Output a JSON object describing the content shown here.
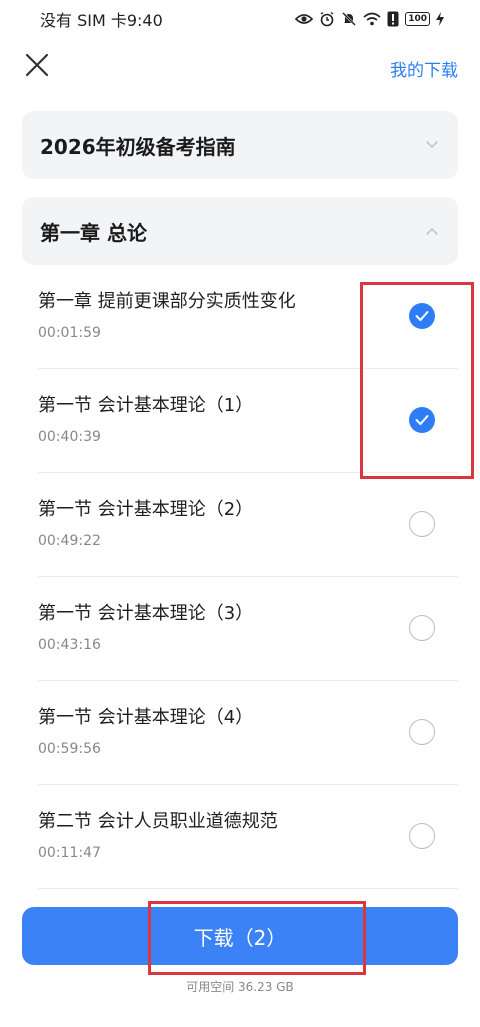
{
  "status_bar": {
    "carrier": "没有 SIM 卡",
    "time": "9:40",
    "battery": "100"
  },
  "header": {
    "close_icon": "close-icon",
    "my_downloads": "我的下载"
  },
  "sections": [
    {
      "title": "2026年初级备考指南",
      "expanded": false
    },
    {
      "title": "第一章 总论",
      "expanded": true
    }
  ],
  "items": [
    {
      "title": "第一章 提前更课部分实质性变化",
      "duration": "00:01:59",
      "checked": true
    },
    {
      "title": "第一节 会计基本理论（1）",
      "duration": "00:40:39",
      "checked": true
    },
    {
      "title": "第一节 会计基本理论（2）",
      "duration": "00:49:22",
      "checked": false
    },
    {
      "title": "第一节 会计基本理论（3）",
      "duration": "00:43:16",
      "checked": false
    },
    {
      "title": "第一节 会计基本理论（4）",
      "duration": "00:59:56",
      "checked": false
    },
    {
      "title": "第二节 会计人员职业道德规范",
      "duration": "00:11:47",
      "checked": false
    }
  ],
  "download": {
    "label": "下载（2）",
    "space_info": "可用空间 36.23 GB"
  },
  "colors": {
    "accent": "#2f7df6",
    "highlight": "#d9363e"
  }
}
